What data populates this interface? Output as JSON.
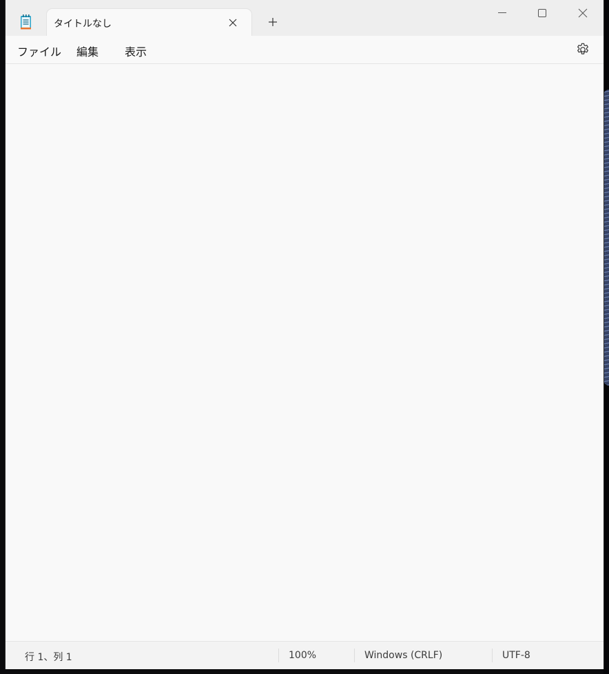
{
  "window": {
    "tab_title": "タイトルなし"
  },
  "menu": {
    "file": "ファイル",
    "edit": "編集",
    "view": "表示"
  },
  "status": {
    "position": "行 1、列 1",
    "zoom": "100%",
    "line_ending": "Windows (CRLF)",
    "encoding": "UTF-8"
  },
  "icons": {
    "app": "notepad-icon",
    "tab_close": "close-icon",
    "new_tab": "plus-icon",
    "minimize": "minimize-icon",
    "maximize": "maximize-icon",
    "close": "close-icon",
    "settings": "gear-icon"
  },
  "colors": {
    "window_bg": "#f9f9f9",
    "titlebar_bg": "#eeeeee",
    "statusbar_bg": "#f3f3f3",
    "text": "#1a1a1a"
  }
}
